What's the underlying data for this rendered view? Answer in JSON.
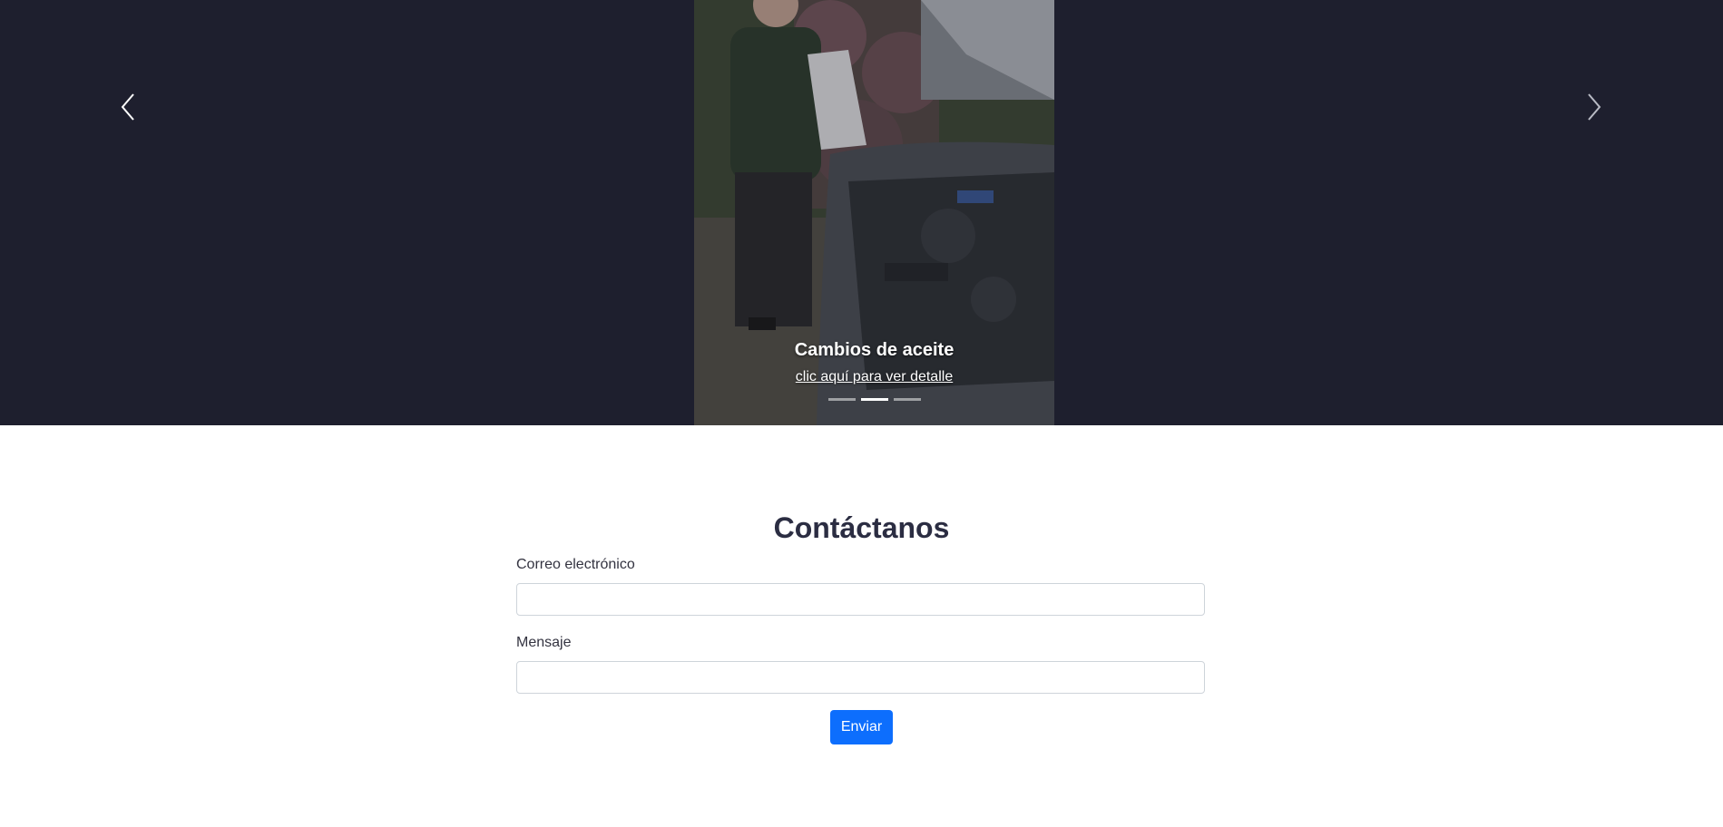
{
  "carousel": {
    "caption_title": "Cambios de aceite",
    "caption_link": "clic aquí para ver detalle",
    "active_indicator": 2,
    "indicator_count": 3,
    "prev_icon": "chevron-left-icon",
    "next_icon": "chevron-right-icon",
    "background_color": "#1e1f2e"
  },
  "contact": {
    "title": "Contáctanos",
    "email_label": "Correo electrónico",
    "email_value": "",
    "message_label": "Mensaje",
    "message_value": "",
    "submit_label": "Enviar",
    "accent_color": "#0d6efd"
  }
}
